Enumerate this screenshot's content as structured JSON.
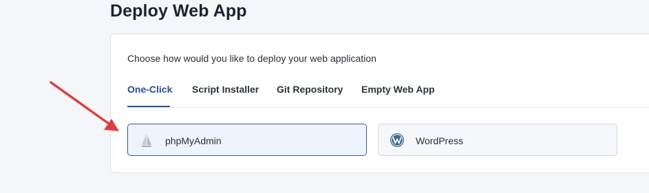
{
  "page": {
    "title": "Deploy Web App"
  },
  "card": {
    "description": "Choose how would you like to deploy your web application"
  },
  "tabs": [
    {
      "label": "One-Click",
      "active": true
    },
    {
      "label": "Script Installer",
      "active": false
    },
    {
      "label": "Git Repository",
      "active": false
    },
    {
      "label": "Empty Web App",
      "active": false
    }
  ],
  "apps": [
    {
      "label": "phpMyAdmin",
      "icon": "phpmyadmin-sail-icon",
      "selected": true
    },
    {
      "label": "WordPress",
      "icon": "wordpress-icon",
      "selected": false
    }
  ],
  "colors": {
    "accent": "#2b4d9c",
    "arrow": "#e03e3e",
    "selected_bg": "#eef4fd"
  }
}
